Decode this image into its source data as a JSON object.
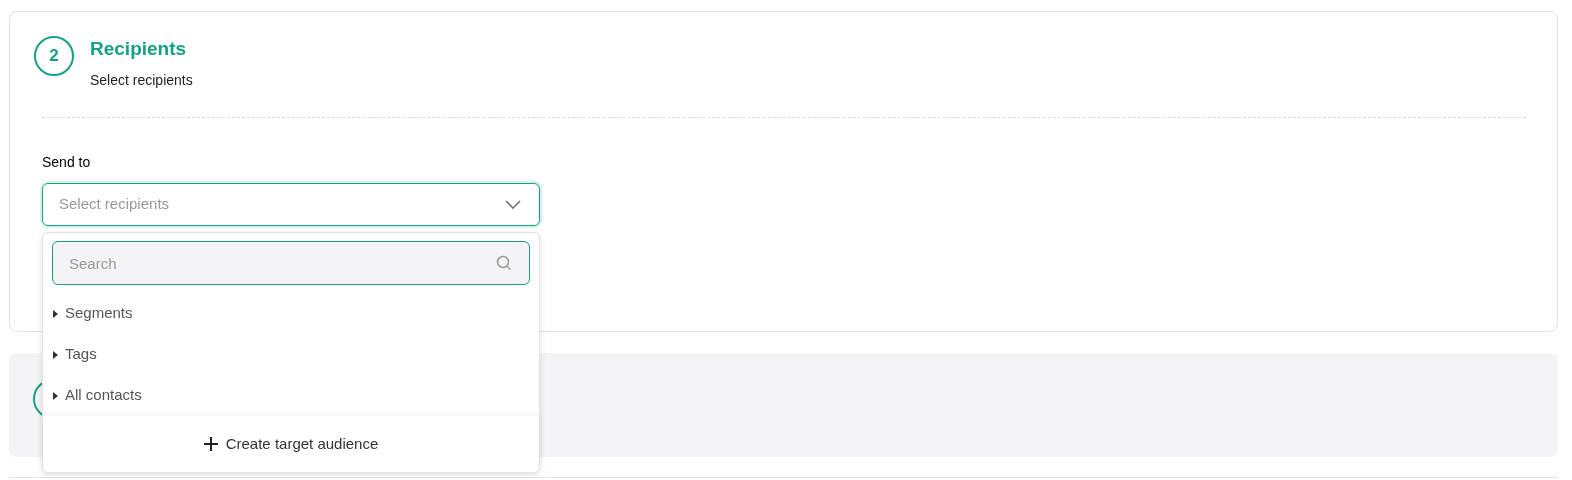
{
  "step": {
    "number": "2",
    "title": "Recipients",
    "subtitle": "Select recipients"
  },
  "send_to": {
    "label": "Send to",
    "placeholder": "Select recipients",
    "expanded": true
  },
  "dropdown": {
    "search_placeholder": "Search",
    "items": [
      {
        "label": "Segments",
        "expanded": false
      },
      {
        "label": "Tags",
        "expanded": false
      },
      {
        "label": "All contacts",
        "expanded": false
      }
    ],
    "footer_button": "Create target audience"
  }
}
